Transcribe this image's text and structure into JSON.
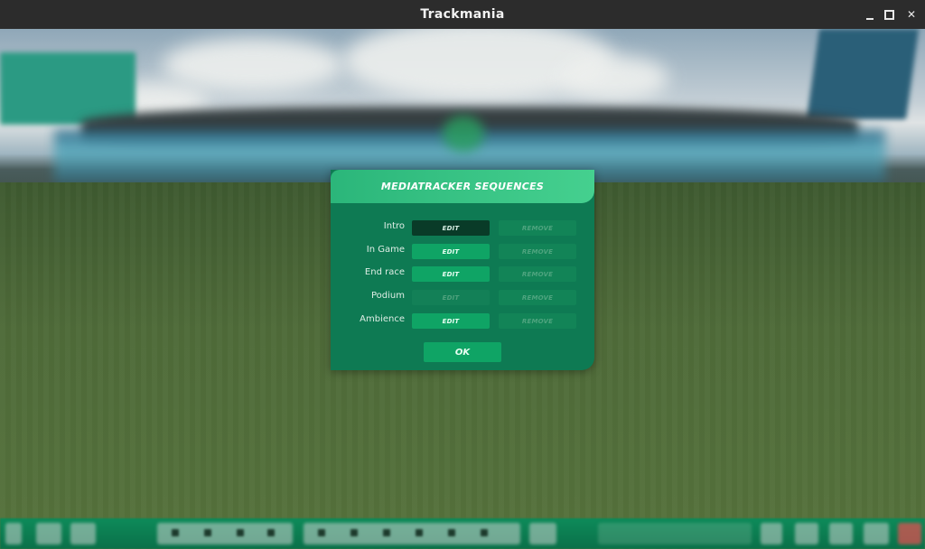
{
  "window": {
    "title": "Trackmania",
    "controls": {
      "minimize_icon": "minimize-icon",
      "maximize_icon": "maximize-icon",
      "close_icon": "close-icon",
      "close_glyph": "✕"
    }
  },
  "dialog": {
    "title": "MEDIATRACKER SEQUENCES",
    "rows": [
      {
        "label": "Intro",
        "edit": "EDIT",
        "remove": "REMOVE",
        "edit_state": "active"
      },
      {
        "label": "In Game",
        "edit": "EDIT",
        "remove": "REMOVE",
        "edit_state": "enabled"
      },
      {
        "label": "End race",
        "edit": "EDIT",
        "remove": "REMOVE",
        "edit_state": "enabled"
      },
      {
        "label": "Podium",
        "edit": "EDIT",
        "remove": "REMOVE",
        "edit_state": "disabled"
      },
      {
        "label": "Ambience",
        "edit": "EDIT",
        "remove": "REMOVE",
        "edit_state": "enabled"
      }
    ],
    "ok_label": "OK"
  },
  "colors": {
    "dialog_bg": "#0e7a53",
    "header_gradient_start": "#2bb67a",
    "header_gradient_end": "#45d08f",
    "edit_button": "#0fa465",
    "edit_button_active": "#093b28",
    "remove_button_disabled": "#128457",
    "toolbar": "#0d8a59"
  }
}
